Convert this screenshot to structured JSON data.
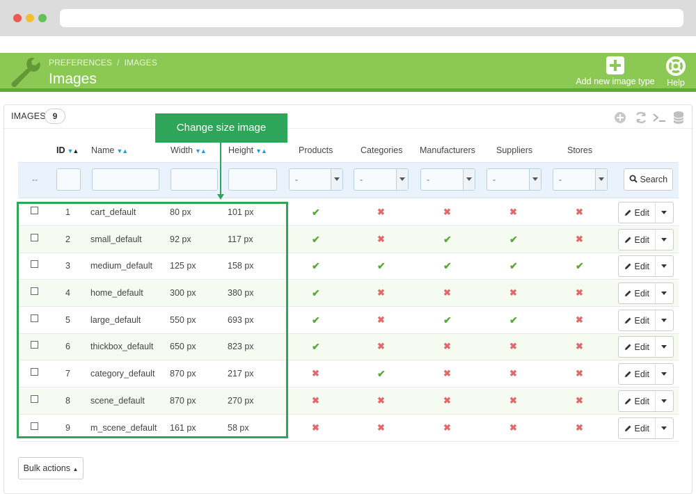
{
  "header": {
    "breadcrumb": [
      "PREFERENCES",
      "IMAGES"
    ],
    "breadcrumb_separator": "/",
    "title": "Images",
    "add_label": "Add new image type",
    "help_label": "Help"
  },
  "panel": {
    "title": "IMAGES",
    "count": "9"
  },
  "callout": {
    "text": "Change size image",
    "color": "#2fa55a"
  },
  "columns": {
    "id": "ID",
    "name": "Name",
    "width": "Width",
    "height": "Height",
    "products": "Products",
    "categories": "Categories",
    "manufacturers": "Manufacturers",
    "suppliers": "Suppliers",
    "stores": "Stores"
  },
  "filters": {
    "dashes": "--",
    "select_value": "-",
    "search_label": "Search"
  },
  "rows": [
    {
      "id": "1",
      "name": "cart_default",
      "width": "80 px",
      "height": "101 px",
      "products": true,
      "categories": false,
      "manufacturers": false,
      "suppliers": false,
      "stores": false
    },
    {
      "id": "2",
      "name": "small_default",
      "width": "92 px",
      "height": "117 px",
      "products": true,
      "categories": false,
      "manufacturers": true,
      "suppliers": true,
      "stores": false
    },
    {
      "id": "3",
      "name": "medium_default",
      "width": "125 px",
      "height": "158 px",
      "products": true,
      "categories": true,
      "manufacturers": true,
      "suppliers": true,
      "stores": true
    },
    {
      "id": "4",
      "name": "home_default",
      "width": "300 px",
      "height": "380 px",
      "products": true,
      "categories": false,
      "manufacturers": false,
      "suppliers": false,
      "stores": false
    },
    {
      "id": "5",
      "name": "large_default",
      "width": "550 px",
      "height": "693 px",
      "products": true,
      "categories": false,
      "manufacturers": true,
      "suppliers": true,
      "stores": false
    },
    {
      "id": "6",
      "name": "thickbox_default",
      "width": "650 px",
      "height": "823 px",
      "products": true,
      "categories": false,
      "manufacturers": false,
      "suppliers": false,
      "stores": false
    },
    {
      "id": "7",
      "name": "category_default",
      "width": "870 px",
      "height": "217 px",
      "products": false,
      "categories": true,
      "manufacturers": false,
      "suppliers": false,
      "stores": false
    },
    {
      "id": "8",
      "name": "scene_default",
      "width": "870 px",
      "height": "270 px",
      "products": false,
      "categories": false,
      "manufacturers": false,
      "suppliers": false,
      "stores": false
    },
    {
      "id": "9",
      "name": "m_scene_default",
      "width": "161 px",
      "height": "58 px",
      "products": false,
      "categories": false,
      "manufacturers": false,
      "suppliers": false,
      "stores": false
    }
  ],
  "row_action": {
    "edit_label": "Edit"
  },
  "footer": {
    "bulk_label": "Bulk actions"
  },
  "colors": {
    "header_green": "#8bc954",
    "check_green": "#5ba83a",
    "cross_red": "#e06a6a",
    "sort_blue": "#1a9fde"
  }
}
